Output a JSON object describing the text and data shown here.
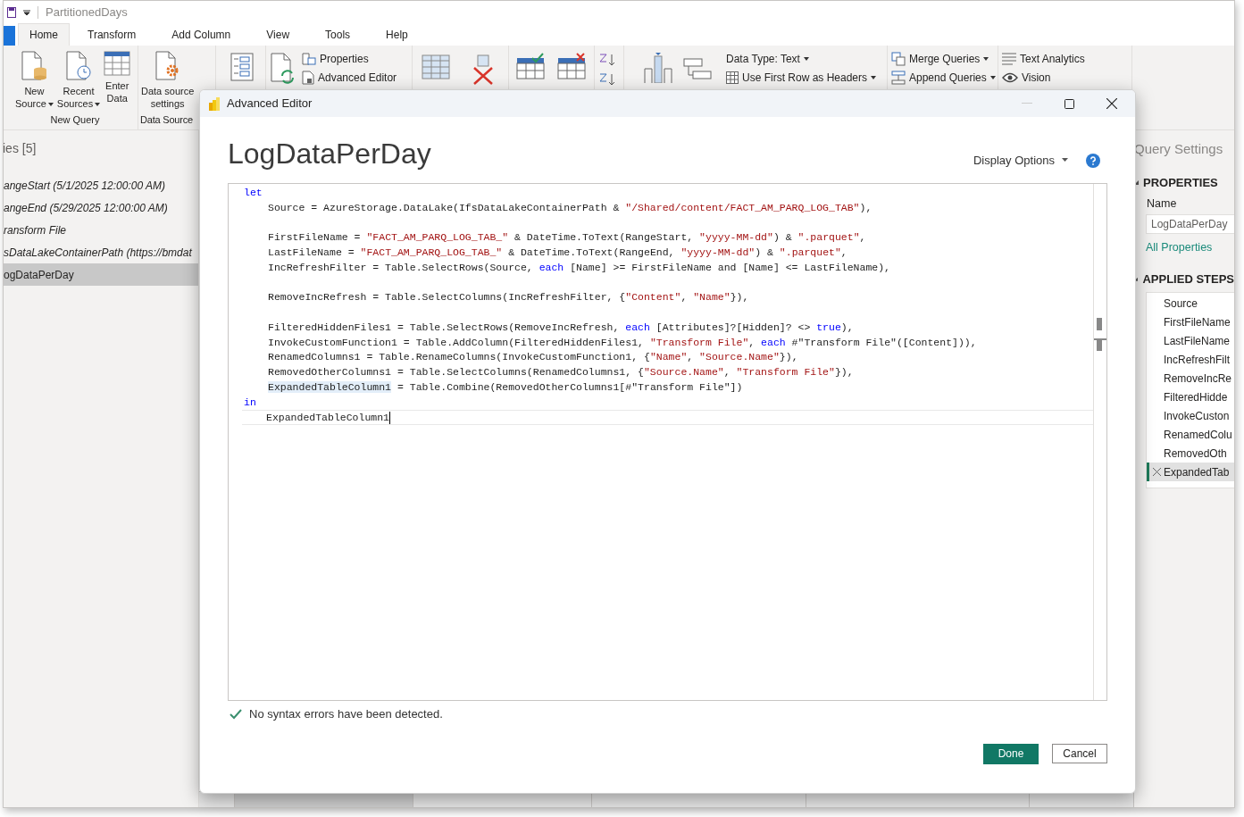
{
  "app": {
    "title": "PartitionedDays",
    "tabs": [
      {
        "label": "Home",
        "selected": true
      },
      {
        "label": "Transform",
        "selected": false
      },
      {
        "label": "Add Column",
        "selected": false
      },
      {
        "label": "View",
        "selected": false
      },
      {
        "label": "Tools",
        "selected": false
      },
      {
        "label": "Help",
        "selected": false
      }
    ]
  },
  "ribbon": {
    "big_buttons": [
      {
        "lines": [
          "New",
          "Source"
        ],
        "dropdown": true
      },
      {
        "lines": [
          "Recent",
          "Sources"
        ],
        "dropdown": true
      },
      {
        "lines": [
          "Enter",
          "Data"
        ],
        "dropdown": false
      },
      {
        "lines": [
          "Data source",
          "settings"
        ],
        "dropdown": false
      }
    ],
    "group_labels": [
      "New Query",
      "Data Source"
    ],
    "small_buttons": [
      {
        "label": "Properties",
        "dropdown": false
      },
      {
        "label": "Advanced Editor",
        "dropdown": false
      },
      {
        "label": "Data Type: Text",
        "dropdown": true
      },
      {
        "label": "Use First Row as Headers",
        "dropdown": true
      },
      {
        "label": "Merge Queries",
        "dropdown": true
      },
      {
        "label": "Append Queries",
        "dropdown": true
      },
      {
        "label": "Text Analytics",
        "dropdown": false
      },
      {
        "label": "Vision",
        "dropdown": false
      }
    ]
  },
  "queries_panel": {
    "header": "ies [5]",
    "items": [
      {
        "label": "angeStart (5/1/2025 12:00:00 AM)",
        "italic": true,
        "selected": false
      },
      {
        "label": "angeEnd (5/29/2025 12:00:00 AM)",
        "italic": true,
        "selected": false
      },
      {
        "label": "ransform File",
        "italic": true,
        "selected": false
      },
      {
        "label": "sDataLakeContainerPath (https://bmdat",
        "italic": true,
        "selected": false
      },
      {
        "label": "ogDataPerDay",
        "italic": false,
        "selected": true
      }
    ]
  },
  "query_settings": {
    "title": "Query Settings",
    "properties_header": "PROPERTIES",
    "name_label": "Name",
    "name_value": "LogDataPerDay",
    "all_properties": "All Properties",
    "steps_header": "APPLIED STEPS",
    "steps": [
      {
        "label": "Source",
        "selected": false
      },
      {
        "label": "FirstFileName",
        "selected": false
      },
      {
        "label": "LastFileName",
        "selected": false
      },
      {
        "label": "IncRefreshFilt",
        "selected": false
      },
      {
        "label": "RemoveIncRe",
        "selected": false
      },
      {
        "label": "FilteredHidde",
        "selected": false
      },
      {
        "label": "InvokeCuston",
        "selected": false
      },
      {
        "label": "RenamedColu",
        "selected": false
      },
      {
        "label": "RemovedOth",
        "selected": false
      },
      {
        "label": "ExpandedTab",
        "selected": true
      }
    ]
  },
  "dialog": {
    "title": "Advanced Editor",
    "heading": "LogDataPerDay",
    "display_options": "Display Options",
    "status": "No syntax errors have been detected.",
    "code": [
      {
        "kind": "code",
        "indented": false,
        "current": false,
        "tokens": [
          {
            "kind": "keyword",
            "text": "let"
          }
        ]
      },
      {
        "kind": "code",
        "indented": true,
        "current": false,
        "tokens": [
          {
            "kind": "plain",
            "text": "Source = AzureStorage.DataLake(IfsDataLakeContainerPath & "
          },
          {
            "kind": "string",
            "text": "\"/Shared/content/FACT_AM_PARQ_LOG_TAB\""
          },
          {
            "kind": "plain",
            "text": "),"
          }
        ]
      },
      {
        "kind": "blank"
      },
      {
        "kind": "code",
        "indented": true,
        "current": false,
        "tokens": [
          {
            "kind": "plain",
            "text": "FirstFileName = "
          },
          {
            "kind": "string",
            "text": "\"FACT_AM_PARQ_LOG_TAB_\""
          },
          {
            "kind": "plain",
            "text": " & DateTime.ToText(RangeStart, "
          },
          {
            "kind": "string",
            "text": "\"yyyy-MM-dd\""
          },
          {
            "kind": "plain",
            "text": ") & "
          },
          {
            "kind": "string",
            "text": "\".parquet\""
          },
          {
            "kind": "plain",
            "text": ","
          }
        ]
      },
      {
        "kind": "code",
        "indented": true,
        "current": false,
        "tokens": [
          {
            "kind": "plain",
            "text": "LastFileName = "
          },
          {
            "kind": "string",
            "text": "\"FACT_AM_PARQ_LOG_TAB_\""
          },
          {
            "kind": "plain",
            "text": " & DateTime.ToText(RangeEnd, "
          },
          {
            "kind": "string",
            "text": "\"yyyy-MM-dd\""
          },
          {
            "kind": "plain",
            "text": ") & "
          },
          {
            "kind": "string",
            "text": "\".parquet\""
          },
          {
            "kind": "plain",
            "text": ","
          }
        ]
      },
      {
        "kind": "code",
        "indented": true,
        "current": false,
        "tokens": [
          {
            "kind": "plain",
            "text": "IncRefreshFilter = Table.SelectRows(Source, "
          },
          {
            "kind": "keyword",
            "text": "each"
          },
          {
            "kind": "plain",
            "text": " [Name] >= FirstFileName and [Name] <= LastFileName),"
          }
        ]
      },
      {
        "kind": "blank"
      },
      {
        "kind": "code",
        "indented": true,
        "current": false,
        "tokens": [
          {
            "kind": "plain",
            "text": "RemoveIncRefresh = Table.SelectColumns(IncRefreshFilter, {"
          },
          {
            "kind": "string",
            "text": "\"Content\""
          },
          {
            "kind": "plain",
            "text": ", "
          },
          {
            "kind": "string",
            "text": "\"Name\""
          },
          {
            "kind": "plain",
            "text": "}),"
          }
        ]
      },
      {
        "kind": "blank"
      },
      {
        "kind": "code",
        "indented": true,
        "current": false,
        "tokens": [
          {
            "kind": "plain",
            "text": "FilteredHiddenFiles1 = Table.SelectRows(RemoveIncRefresh, "
          },
          {
            "kind": "keyword",
            "text": "each"
          },
          {
            "kind": "plain",
            "text": " [Attributes]?[Hidden]? <> "
          },
          {
            "kind": "keyword",
            "text": "true"
          },
          {
            "kind": "plain",
            "text": "),"
          }
        ]
      },
      {
        "kind": "code",
        "indented": true,
        "current": false,
        "tokens": [
          {
            "kind": "plain",
            "text": "InvokeCustomFunction1 = Table.AddColumn(FilteredHiddenFiles1, "
          },
          {
            "kind": "string",
            "text": "\"Transform File\""
          },
          {
            "kind": "plain",
            "text": ", "
          },
          {
            "kind": "keyword",
            "text": "each"
          },
          {
            "kind": "plain",
            "text": " #\"Transform File\"([Content])),"
          }
        ]
      },
      {
        "kind": "code",
        "indented": true,
        "current": false,
        "tokens": [
          {
            "kind": "plain",
            "text": "RenamedColumns1 = Table.RenameColumns(InvokeCustomFunction1, {"
          },
          {
            "kind": "string",
            "text": "\"Name\""
          },
          {
            "kind": "plain",
            "text": ", "
          },
          {
            "kind": "string",
            "text": "\"Source.Name\""
          },
          {
            "kind": "plain",
            "text": "}),"
          }
        ]
      },
      {
        "kind": "code",
        "indented": true,
        "current": false,
        "tokens": [
          {
            "kind": "plain",
            "text": "RemovedOtherColumns1 = Table.SelectColumns(RenamedColumns1, {"
          },
          {
            "kind": "string",
            "text": "\"Source.Name\""
          },
          {
            "kind": "plain",
            "text": ", "
          },
          {
            "kind": "string",
            "text": "\"Transform File\""
          },
          {
            "kind": "plain",
            "text": "}),"
          }
        ]
      },
      {
        "kind": "code",
        "indented": true,
        "current": false,
        "tokens": [
          {
            "kind": "highlight",
            "text": "ExpandedTableColumn1"
          },
          {
            "kind": "plain",
            "text": " = Table.Combine(RemovedOtherColumns1[#\"Transform File\"])"
          }
        ]
      },
      {
        "kind": "code",
        "indented": false,
        "current": false,
        "tokens": [
          {
            "kind": "keyword",
            "text": "in"
          }
        ]
      },
      {
        "kind": "code",
        "indented": true,
        "current": true,
        "tokens": [
          {
            "kind": "plain",
            "text": "ExpandedTableColumn1"
          }
        ]
      }
    ],
    "buttons": [
      {
        "label": "Done",
        "primary": true
      },
      {
        "label": "Cancel",
        "primary": false
      }
    ]
  }
}
